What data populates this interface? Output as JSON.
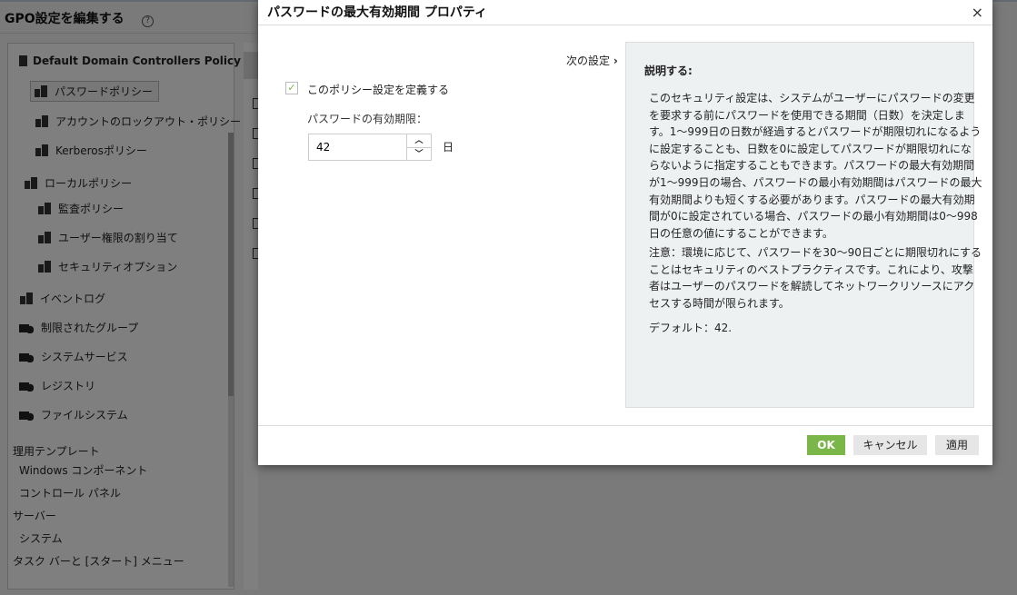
{
  "app": {
    "title": "GPO設定を編集する",
    "help": "?"
  },
  "tree": {
    "root": "Default Domain Controllers Policy",
    "items": [
      "パスワードポリシー",
      "アカウントのロックアウト・ポリシー",
      "Kerberosポリシー",
      "ローカルポリシー",
      "監査ポリシー",
      "ユーザー権限の割り当て",
      "セキュリティオプション",
      "イベントログ",
      "制限されたグループ",
      "システムサービス",
      "レジストリ",
      "ファイルシステム",
      "理用テンプレート",
      "Windows コンポーネント",
      "コントロール パネル",
      "サーバー",
      "システム",
      "タスク バーと [スタート] メニュー"
    ]
  },
  "dialog": {
    "title": "パスワードの最大有効期間 プロパティ",
    "close": "×",
    "next": "次の設定",
    "define_label": "このポリシー設定を定義する",
    "define_checked": true,
    "field_label": "パスワードの有効期限：",
    "value": "42",
    "unit": "日",
    "desc_title": "説明する:",
    "desc_lines": [
      "このセキュリティ設定は、システムがユーザーにパスワードの変更",
      "を要求する前にパスワードを使用できる期間（日数）を決定しま",
      "す。1～999日の日数が経過するとパスワードが期限切れになるよう",
      "に設定することも、日数を0に設定してパスワードが期限切れにな",
      "らないように指定することもできます。パスワードの最大有効期間",
      "が1～999日の場合、パスワードの最小有効期間はパスワードの最大",
      "有効期間よりも短くする必要があります。パスワードの最大有効期",
      "間が0に設定されている場合、パスワードの最小有効期間は0～998",
      "日の任意の値にすることができます。"
    ],
    "note_lines": [
      "注意：環境に応じて、パスワードを30～90日ごとに期限切れにする",
      "ことはセキュリティのベストプラクティスです。これにより、攻撃",
      "者はユーザーのパスワードを解読してネットワークリソースにアク",
      "セスする時間が限られます。"
    ],
    "default_text": "デフォルト：42.",
    "ok": "OK",
    "cancel": "キャンセル",
    "apply": "適用"
  },
  "colors": {
    "ok": "#7ab648",
    "desc_bg": "#eef1f2"
  }
}
